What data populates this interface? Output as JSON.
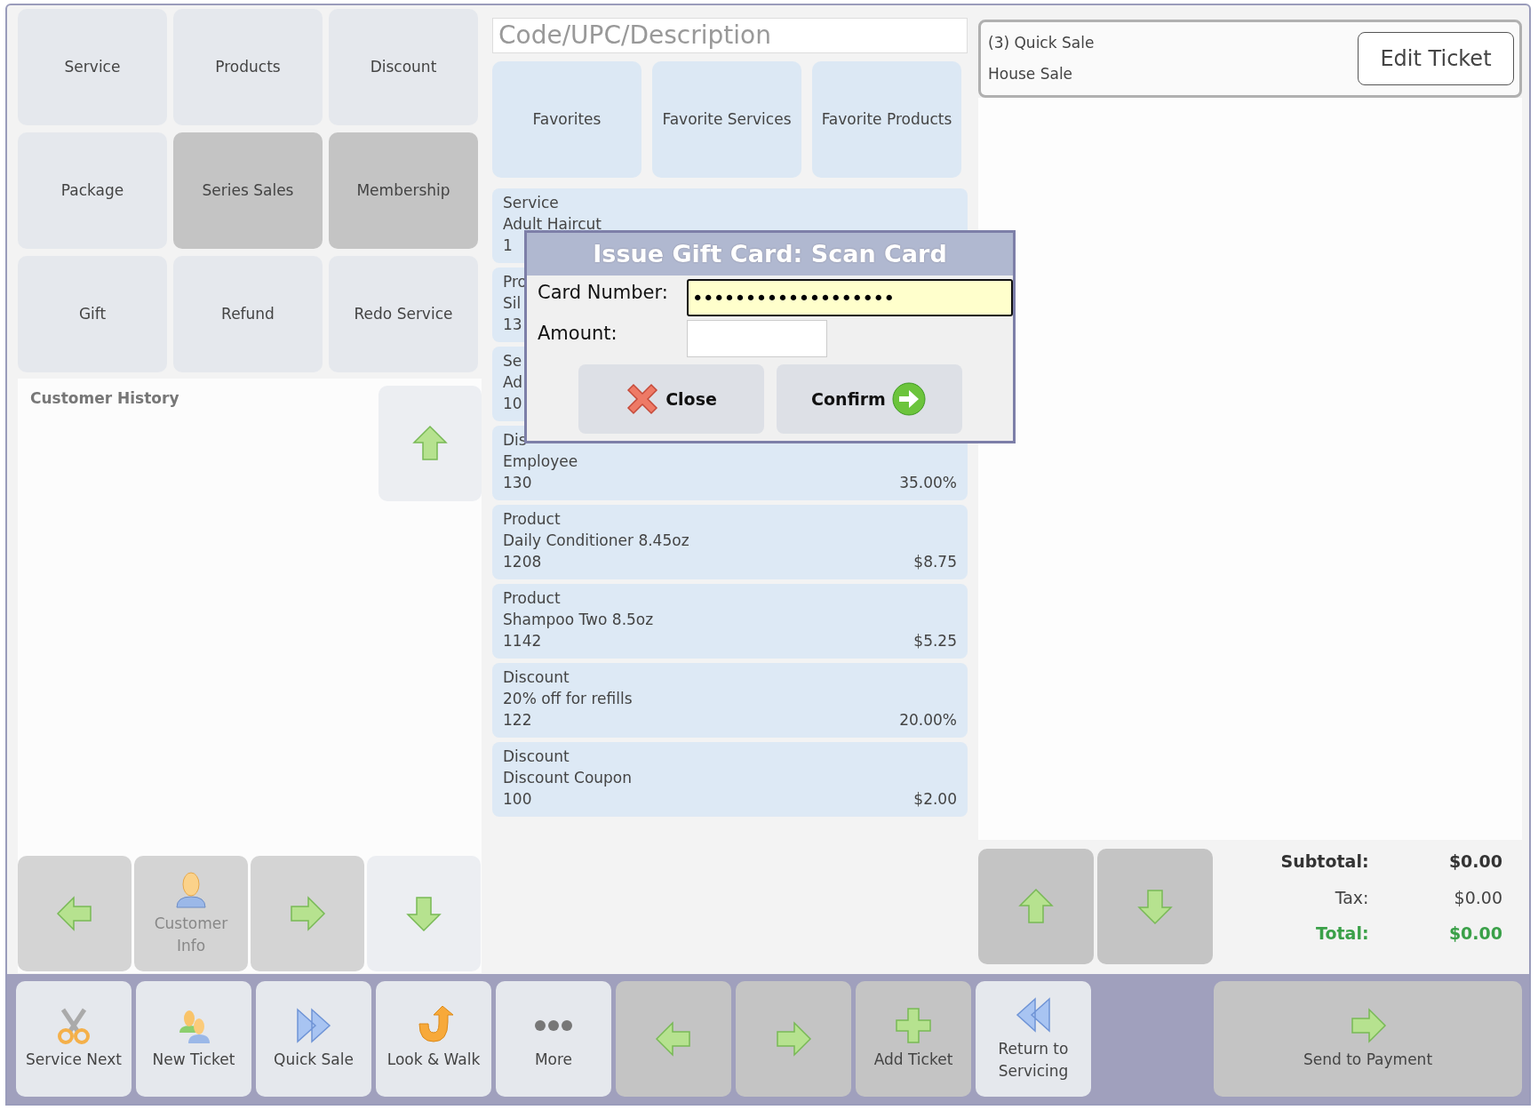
{
  "categories": [
    {
      "label": "Service",
      "disabled": false
    },
    {
      "label": "Products",
      "disabled": false
    },
    {
      "label": "Discount",
      "disabled": false
    },
    {
      "label": "Package",
      "disabled": false
    },
    {
      "label": "Series Sales",
      "disabled": true
    },
    {
      "label": "Membership",
      "disabled": true
    },
    {
      "label": "Gift",
      "disabled": false
    },
    {
      "label": "Refund",
      "disabled": false
    },
    {
      "label": "Redo Service",
      "disabled": false
    }
  ],
  "customer_history": {
    "title": "Customer History",
    "scroll_up": {
      "disabled": false
    }
  },
  "customer_nav": [
    {
      "kind": "left",
      "disabled": true
    },
    {
      "kind": "customer",
      "label": "Customer Info",
      "disabled": true
    },
    {
      "kind": "right",
      "disabled": true
    },
    {
      "kind": "down",
      "disabled": false
    }
  ],
  "search": {
    "placeholder": "Code/UPC/Description"
  },
  "favorites": [
    {
      "label": "Favorites"
    },
    {
      "label": "Favorite Services"
    },
    {
      "label": "Favorite Products"
    }
  ],
  "items": [
    {
      "category": "Service",
      "name": "Adult Haircut",
      "code": "1"
    },
    {
      "category": "Pro",
      "name": "Sil",
      "code": "13"
    },
    {
      "category": "Se",
      "name": "Ad",
      "code": "10"
    },
    {
      "category": "Dis",
      "name": "Employee",
      "code": "130",
      "price": "35.00%"
    },
    {
      "category": "Product",
      "name": "Daily Conditioner 8.45oz",
      "code": "1208",
      "price": "$8.75"
    },
    {
      "category": "Product",
      "name": "Shampoo Two 8.5oz",
      "code": "1142",
      "price": "$5.25"
    },
    {
      "category": "Discount",
      "name": "20% off for refills",
      "code": "122",
      "price": "20.00%"
    },
    {
      "category": "Discount",
      "name": "Discount Coupon",
      "code": "100",
      "price": "$2.00"
    }
  ],
  "ticket": {
    "title": "(3) Quick Sale",
    "customer": "House Sale",
    "edit_button": "Edit Ticket"
  },
  "ticket_nav": [
    {
      "kind": "up",
      "disabled": true
    },
    {
      "kind": "down",
      "disabled": true
    }
  ],
  "totals": [
    {
      "kind": "subtotal",
      "label": "Subtotal:",
      "value": "$0.00"
    },
    {
      "kind": "tax",
      "label": "Tax:",
      "value": "$0.00"
    },
    {
      "kind": "total",
      "label": "Total:",
      "value": "$0.00"
    }
  ],
  "toolbar": [
    {
      "kind": "scissors",
      "label": "Service Next",
      "disabled": false
    },
    {
      "kind": "people",
      "label": "New Ticket",
      "disabled": false
    },
    {
      "kind": "forward",
      "label": "Quick Sale",
      "disabled": false
    },
    {
      "kind": "uturn",
      "label": "Look & Walk",
      "disabled": false
    },
    {
      "kind": "dots",
      "label": "More",
      "disabled": false
    },
    {
      "kind": "left",
      "disabled": true
    },
    {
      "kind": "right",
      "disabled": true
    },
    {
      "kind": "plus",
      "label": "Add Ticket",
      "disabled": true
    },
    {
      "kind": "rewind",
      "label": "Return to Servicing",
      "disabled": false
    },
    {
      "kind": "right",
      "label": "Send to Payment",
      "disabled": true,
      "wide": true
    }
  ],
  "dialog": {
    "title": "Issue Gift Card: Scan Card",
    "fields": [
      {
        "label": "Card Number:",
        "value": "•••••••••••••••••••",
        "focused": true
      },
      {
        "label": "Amount:",
        "focused": false
      }
    ],
    "buttons": [
      {
        "kind": "close",
        "label": "Close"
      },
      {
        "kind": "confirm",
        "label": "Confirm"
      }
    ]
  }
}
